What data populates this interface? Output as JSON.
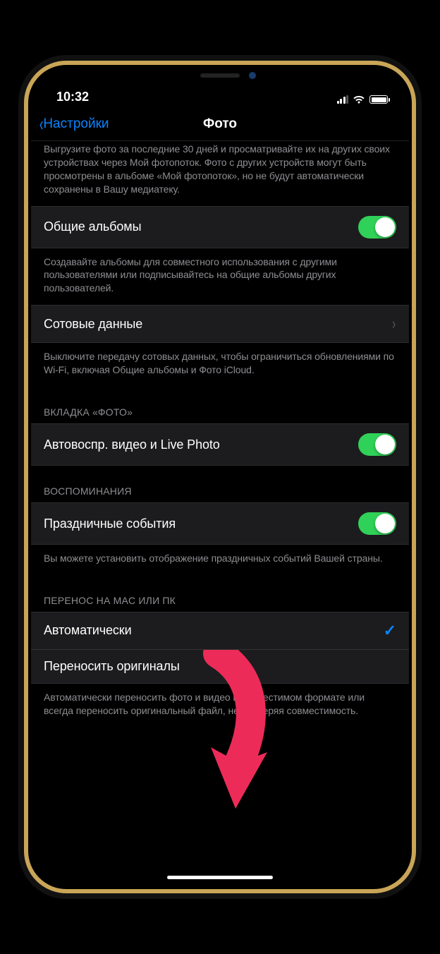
{
  "status": {
    "time": "10:32"
  },
  "nav": {
    "back_label": "Настройки",
    "title": "Фото"
  },
  "section_stream": {
    "footer": "Выгрузите фото за последние 30 дней и просматривайте их на других своих устройствах через Мой фотопоток. Фото с других устройств могут быть просмотрены в альбоме «Мой фотопоток», но не будут автоматически сохранены в Вашу медиатеку."
  },
  "section_shared": {
    "cell_label": "Общие альбомы",
    "footer": "Создавайте альбомы для совместного использования с другими пользователями или подписывайтесь на общие альбомы других пользователей."
  },
  "section_cellular": {
    "cell_label": "Сотовые данные",
    "footer": "Выключите передачу сотовых данных, чтобы ограничиться обновлениями по Wi-Fi, включая Общие альбомы и Фото iCloud."
  },
  "section_photos_tab": {
    "header": "ВКЛАДКА «ФОТО»",
    "cell_label": "Автовоспр. видео и Live Photo"
  },
  "section_memories": {
    "header": "ВОСПОМИНАНИЯ",
    "cell_label": "Праздничные события",
    "footer": "Вы можете установить отображение праздничных событий Вашей страны."
  },
  "section_transfer": {
    "header": "ПЕРЕНОС НА MAC ИЛИ ПК",
    "option_auto": "Автоматически",
    "option_originals": "Переносить оригиналы",
    "footer": "Автоматически переносить фото и видео в совместимом формате или всегда переносить оригинальный файл, не проверяя совместимость."
  }
}
